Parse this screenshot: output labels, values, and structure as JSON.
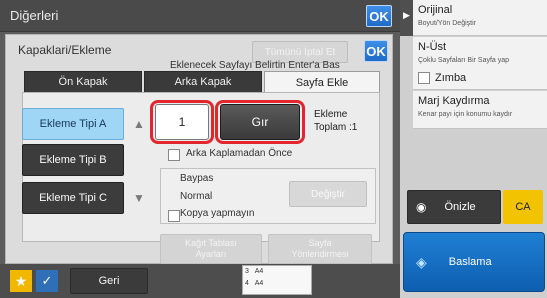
{
  "header": {
    "title": "Diğerleri",
    "ok_label": "OK"
  },
  "dialog": {
    "title": "Kapaklari/Ekleme",
    "ok_label": "OK",
    "cancel_all_label": "Tümünü İptal Et",
    "tabs": [
      {
        "label": "Ön Kapak",
        "active": false
      },
      {
        "label": "Arka Kapak",
        "active": false
      },
      {
        "label": "Sayfa Ekle",
        "active": true
      }
    ],
    "insert_types": [
      {
        "label": "Ekleme Tipi A",
        "selected": true
      },
      {
        "label": "Ekleme Tipi B",
        "selected": false
      },
      {
        "label": "Ekleme Tipi C",
        "selected": false
      }
    ],
    "hint": "Eklenecek Sayfayı Belirtin Enter'a Bas",
    "page_value": "1",
    "enter_label": "Gır",
    "total_label_line1": "Ekleme",
    "total_label_line2": "Toplam :1",
    "back_cover_check_label": "Arka Kaplamadan Önce",
    "paper_source": "Baypas",
    "paper_type": "Normal",
    "change_label": "Değiştir",
    "no_copy_label": "Kopya yapmayın",
    "tray_settings_label_1": "Kağıt Tablası",
    "tray_settings_label_2": "Ayarları",
    "page_orientation_label_1": "Sayfa",
    "page_orientation_label_2": "Yönlendirmesi"
  },
  "right_panel": {
    "items": [
      {
        "main": "Orijinal",
        "sub": "Boyut/Yön Değiştir"
      },
      {
        "main": "N-Üst",
        "sub": "Çoklu Sayfaları Bir Sayfa yap"
      },
      {
        "main": "Zımba",
        "sub": ""
      },
      {
        "main": "Marj Kaydırma",
        "sub": "Kenar payı için konumu kaydır"
      }
    ],
    "preview_label": "Önizle",
    "ca_label": "CA",
    "start_label": "Baslama"
  },
  "bottom": {
    "back_label": "Geri",
    "mini_rows": [
      {
        "a": "3",
        "b": "A4"
      },
      {
        "a": "4",
        "b": "A4"
      }
    ]
  },
  "colors": {
    "accent": "#1f6bc8",
    "selected": "#9fd6f5",
    "highlight_ring": "#e3262d",
    "ca": "#f2c300"
  }
}
